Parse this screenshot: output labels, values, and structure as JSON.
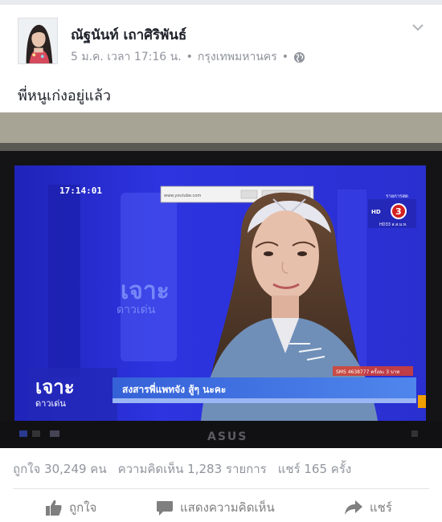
{
  "post": {
    "author": "ณัฐนันท์ เถาศิริพันธ์",
    "meta": {
      "date": "5 ม.ค. เวลา 17:16 น.",
      "separator": "•",
      "location": "กรุงเทพมหานคร",
      "privacy_icon": "globe-icon"
    },
    "text": "พี่หนูเก่งอยู่แล้ว"
  },
  "photo": {
    "tv_brand": "ASUS",
    "broadcast": {
      "clock": "17:14:01",
      "channel_badge": "3",
      "channel_top": "รายการสด",
      "channel_bottom": "HD33 ส.ส.ม.ท.",
      "show_title_top": "เจาะ",
      "show_title_bottom": "ดาวเด่น",
      "caption": "สงสารพี่แพทจัง สู้ๆ นะคะ",
      "sms_text": "SMS 4638777 ครั้งละ 3 บาท",
      "browser_url": "www.youtube.com"
    }
  },
  "stats": {
    "likes": "ถูกใจ 30,249 คน",
    "comments": "ความคิดเห็น 1,283 รายการ",
    "shares": "แชร์ 165 ครั้ง"
  },
  "actions": {
    "like_label": "ถูกใจ",
    "comment_label": "แสดงความคิดเห็น",
    "share_label": "แชร์",
    "like_icon": "thumbs-up-icon",
    "comment_icon": "comment-bubble-icon",
    "share_icon": "share-arrow-icon"
  },
  "colors": {
    "text_primary": "#1d2129",
    "text_secondary": "#90949c",
    "action_grey": "#7f7f7f",
    "tv_blue": "#2b2fd6",
    "caption_bar": "#3f6fe0"
  }
}
